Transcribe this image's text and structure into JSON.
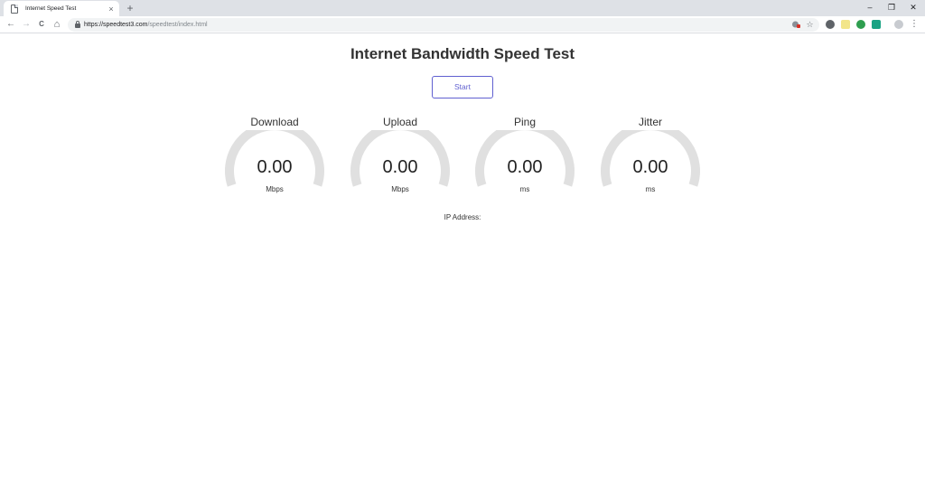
{
  "browser": {
    "tab": {
      "title": "Internet Speed Test",
      "close_glyph": "×"
    },
    "new_tab_glyph": "+",
    "window_controls": {
      "minimize": "–",
      "restore": "❐",
      "close": "✕"
    },
    "nav": {
      "back": "←",
      "forward": "→",
      "reload": "C",
      "home": "⌂"
    },
    "address": {
      "host": "https://speedtest3.com",
      "path": "/speedtest/index.html"
    },
    "omnibox_icons": {
      "bookmark": "☆"
    },
    "menu_glyph": "⋮"
  },
  "page": {
    "title": "Internet Bandwidth Speed Test",
    "start_label": "Start",
    "gauges": [
      {
        "label": "Download",
        "value": "0.00",
        "unit": "Mbps"
      },
      {
        "label": "Upload",
        "value": "0.00",
        "unit": "Mbps"
      },
      {
        "label": "Ping",
        "value": "0.00",
        "unit": "ms"
      },
      {
        "label": "Jitter",
        "value": "0.00",
        "unit": "ms"
      }
    ],
    "ip_label": "IP Address:"
  },
  "colors": {
    "accent": "#6060d0",
    "gauge_track": "#e0e0e0",
    "text": "#333333"
  },
  "icons": {
    "tab_favicon": "page-icon",
    "lock": "lock-icon",
    "bookmark": "star-icon"
  }
}
